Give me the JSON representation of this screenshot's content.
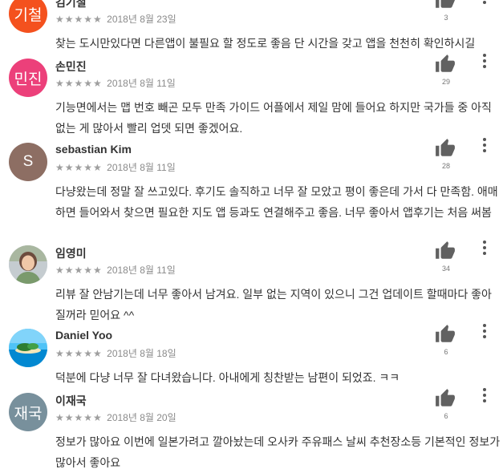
{
  "reviews": [
    {
      "name": "김기철",
      "avatar_text": "기철",
      "avatar_color": "#f4511e",
      "stars": "★★★★★",
      "date": "2018년 8월 23일",
      "likes": "3",
      "text": "찾는 도시만있다면 다른앱이 불필요 할 정도로 좋음 단 시간을 갖고 앱을 천천히 확인하시길"
    },
    {
      "name": "손민진",
      "avatar_text": "민진",
      "avatar_color": "#ec407a",
      "stars": "★★★★★",
      "date": "2018년 8월 11일",
      "likes": "29",
      "text": "기능면에서는 맵 번호 빼곤 모두 만족 가이드 어플에서 제일 맘에 들어요 하지만 국가들 중 아직 없는 게 많아서 빨리 업뎃 되면 좋겠어요."
    },
    {
      "name": "sebastian Kim",
      "avatar_text": "S",
      "avatar_color": "#8d6e63",
      "stars": "★★★★★",
      "date": "2018년 8월 11일",
      "likes": "28",
      "text": "다냥왔는데 정말 잘 쓰고있다. 후기도 솔직하고 너무 잘 모았고 평이 좋은데 가서 다 만족함. 애매하면 들어와서 찾으면 필요한 지도 앱 등과도 연결해주고 좋음. 너무 좋아서 앱후기는 처음 써봄"
    },
    {
      "name": "임영미",
      "avatar_text": "",
      "avatar_color": "#cfd8dc",
      "stars": "★★★★★",
      "date": "2018년 8월 11일",
      "likes": "34",
      "text": "리뷰 잘 안남기는데 너무 좋아서 남겨요. 일부 없는 지역이 있으니 그건 업데이트 할때마다 좋아질꺼라 믿어요 ^^"
    },
    {
      "name": "Daniel Yoo",
      "avatar_text": "",
      "avatar_color": "#4fc3f7",
      "stars": "★★★★★",
      "date": "2018년 8월 18일",
      "likes": "6",
      "text": "덕분에 다냥 너무 잘 다녀왔습니다. 아내에게 칭찬받는 남편이 되었죠. ㅋㅋ"
    },
    {
      "name": "이재국",
      "avatar_text": "재국",
      "avatar_color": "#78909c",
      "stars": "★★★★★",
      "date": "2018년 8월 20일",
      "likes": "6",
      "text": "정보가 많아요 이번에 일본가려고 깔아놨는데 오사카 주유패스 날씨 추천장소등 기본적인 정보가 많아서 좋아요"
    }
  ]
}
